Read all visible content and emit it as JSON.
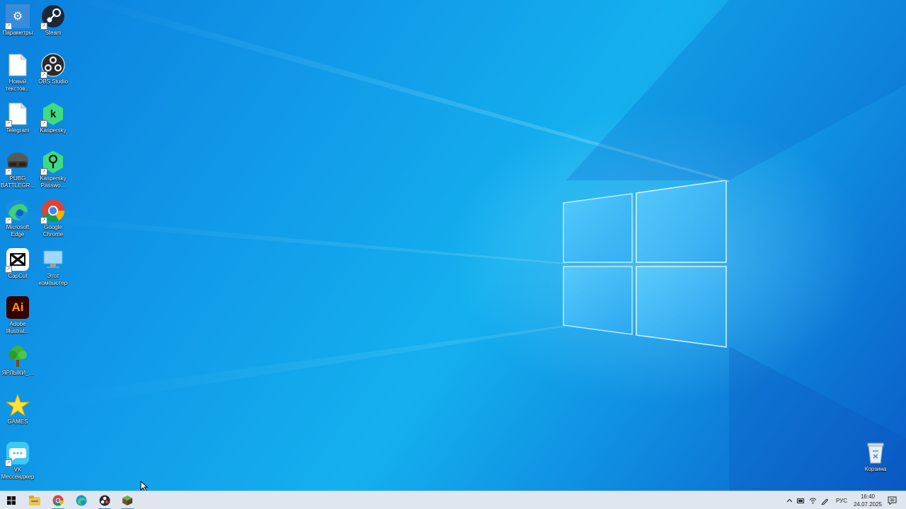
{
  "desktop": {
    "icons_col1": [
      {
        "label": "Параметры",
        "icon": "settings-icon"
      },
      {
        "label": "Новый текстов...",
        "icon": "text-document-icon"
      },
      {
        "label": "Telegram",
        "icon": "document-icon"
      },
      {
        "label": "PUBG BATTLEGR...",
        "icon": "pubg-helmet-icon"
      },
      {
        "label": "Microsoft Edge",
        "icon": "edge-icon"
      },
      {
        "label": "CapCut",
        "icon": "capcut-icon"
      },
      {
        "label": "Adobe Illustrat...",
        "icon": "illustrator-icon",
        "glyph": "Ai"
      },
      {
        "label": "ЯРЛЫКИ_...",
        "icon": "tree-icon"
      },
      {
        "label": "GAMES",
        "icon": "star-icon"
      },
      {
        "label": "VK Мессенджер",
        "icon": "vk-messenger-icon"
      }
    ],
    "icons_col2": [
      {
        "label": "Steam",
        "icon": "steam-icon"
      },
      {
        "label": "OBS Studio",
        "icon": "obs-icon"
      },
      {
        "label": "Kaspersky",
        "icon": "kaspersky-icon",
        "glyph": "k"
      },
      {
        "label": "Kaspersky Passwo...",
        "icon": "kaspersky-password-icon"
      },
      {
        "label": "Google Chrome",
        "icon": "chrome-icon"
      },
      {
        "label": "Этот компьютер",
        "icon": "this-pc-icon"
      }
    ],
    "recycle_bin": {
      "label": "Корзина",
      "icon": "recycle-bin-icon"
    }
  },
  "taskbar": {
    "pinned": [
      {
        "icon": "start-windows-icon"
      },
      {
        "icon": "file-explorer-icon"
      },
      {
        "icon": "chrome-icon"
      },
      {
        "icon": "edge-icon"
      },
      {
        "icon": "obs-icon"
      },
      {
        "icon": "minecraft-icon"
      }
    ],
    "tray": {
      "language": "РУС",
      "time": "16:40",
      "date": "24.07.2025"
    }
  },
  "colors": {
    "accent": "#0a72d6",
    "taskbar_bg": "#dfe6ef",
    "kaspersky_green": "#3ddc84",
    "illustrator_bg": "#330000",
    "illustrator_fg": "#ff9a00"
  }
}
